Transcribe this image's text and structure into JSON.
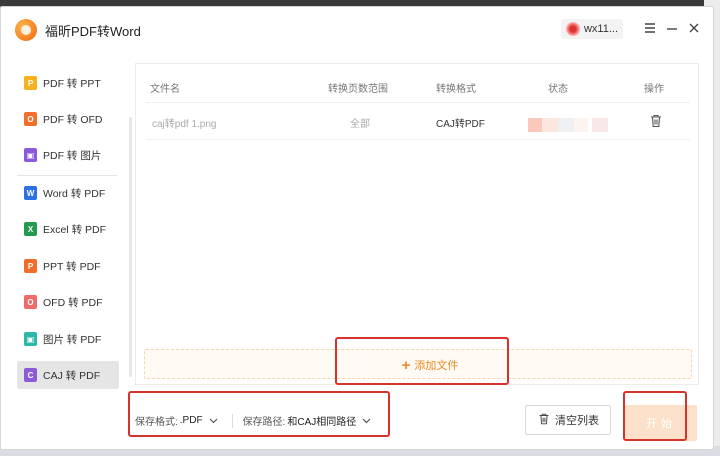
{
  "app": {
    "title": "福昕PDF转Word",
    "user_name": "wx11...",
    "menu_icon": "menu-icon",
    "min_icon": "minimize-icon",
    "close_icon": "close-icon"
  },
  "sidebar": {
    "items": [
      {
        "label": "PDF 转 PPT",
        "icon": "P",
        "color": "#f5b21e"
      },
      {
        "label": "PDF 转 OFD",
        "icon": "O",
        "color": "#f1702e"
      },
      {
        "label": "PDF 转 图片",
        "icon": "▣",
        "color": "#8a5ad8"
      },
      {
        "label": "Word 转 PDF",
        "icon": "W",
        "color": "#2f6fe4"
      },
      {
        "label": "Excel 转 PDF",
        "icon": "X",
        "color": "#239a4f"
      },
      {
        "label": "PPT 转 PDF",
        "icon": "P",
        "color": "#f06d2b"
      },
      {
        "label": "OFD 转 PDF",
        "icon": "O",
        "color": "#ef6b6b"
      },
      {
        "label": "图片 转 PDF",
        "icon": "▣",
        "color": "#2bb8a8"
      },
      {
        "label": "CAJ 转 PDF",
        "icon": "C",
        "color": "#8a5ad8"
      }
    ]
  },
  "table": {
    "headers": [
      "文件名",
      "转换页数范围",
      "转换格式",
      "状态",
      "操作"
    ],
    "rows": [
      {
        "file": "caj转pdf 1.png",
        "range": "全部",
        "format": "CAJ转PDF"
      }
    ]
  },
  "add_file_label": "添加文件",
  "footer": {
    "format_label": "保存格式:",
    "format_value": ".PDF",
    "path_label": "保存路径:",
    "path_value": "和CAJ相同路径"
  },
  "clear_label": "清空列表",
  "start_label": "开始"
}
